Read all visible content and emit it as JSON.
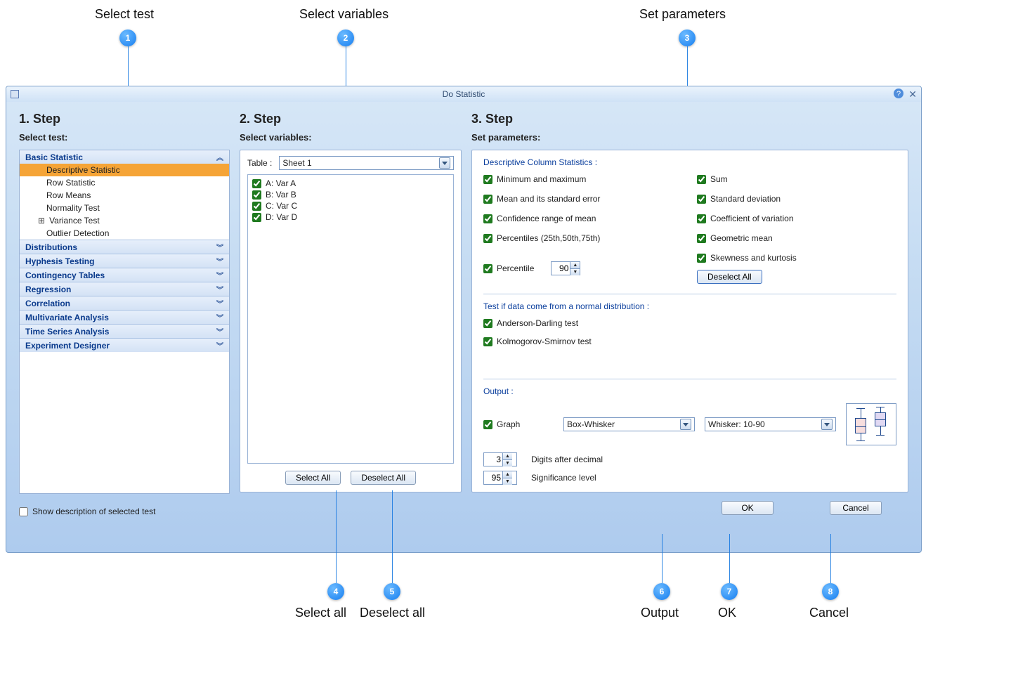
{
  "callouts": {
    "c1": "Select test",
    "c2": "Select variables",
    "c3": "Set parameters",
    "c4": "Select all",
    "c5": "Deselect all",
    "c6": "Output",
    "c7": "OK",
    "c8": "Cancel",
    "n1": "1",
    "n2": "2",
    "n3": "3",
    "n4": "4",
    "n5": "5",
    "n6": "6",
    "n7": "7",
    "n8": "8"
  },
  "window": {
    "title": "Do Statistic"
  },
  "step1": {
    "heading": "1. Step",
    "sub": "Select test:",
    "tree": {
      "basic": {
        "label": "Basic Statistic",
        "items": {
          "desc": "Descriptive Statistic",
          "row": "Row Statistic",
          "means": "Row Means",
          "norm": "Normality Test",
          "var": "Variance Test",
          "out": "Outlier Detection"
        }
      },
      "dist": "Distributions",
      "hyp": "Hyphesis Testing",
      "cont": "Contingency Tables",
      "reg": "Regression",
      "corr": "Correlation",
      "mva": "Multivariate Analysis",
      "tsa": "Time Series Analysis",
      "exp": "Experiment Designer"
    },
    "show_desc": "Show description of selected test"
  },
  "step2": {
    "heading": "2. Step",
    "sub": "Select variables:",
    "table_label": "Table :",
    "table_selected": "Sheet 1",
    "vars": {
      "a": "A: Var A",
      "b": "B: Var B",
      "c": "C: Var C",
      "d": "D: Var D"
    },
    "select_all": "Select All",
    "deselect_all": "Deselect All"
  },
  "step3": {
    "heading": "3. Step",
    "sub": "Set parameters:",
    "desc_title": "Descriptive Column Statistics :",
    "opts": {
      "minmax": "Minimum and maximum",
      "sum": "Sum",
      "mean": "Mean and its standard error",
      "sd": "Standard deviation",
      "ci": "Confidence range of mean",
      "cv": "Coefficient of variation",
      "pct3": "Percentiles (25th,50th,75th)",
      "gm": "Geometric mean",
      "pctl": "Percentile",
      "pctl_val": "90",
      "sk": "Skewness and kurtosis"
    },
    "deselect_all": "Deselect All",
    "norm_title": "Test if data come from a normal distribution :",
    "norm": {
      "ad": "Anderson-Darling test",
      "ks": "Kolmogorov-Smirnov test"
    },
    "out_title": "Output :",
    "out": {
      "graph": "Graph",
      "graph_type": "Box-Whisker",
      "whisker": "Whisker: 10-90",
      "digits_label": "Digits after decimal",
      "digits": "3",
      "sig_label": "Significance level",
      "sig": "95"
    }
  },
  "buttons": {
    "ok": "OK",
    "cancel": "Cancel"
  }
}
